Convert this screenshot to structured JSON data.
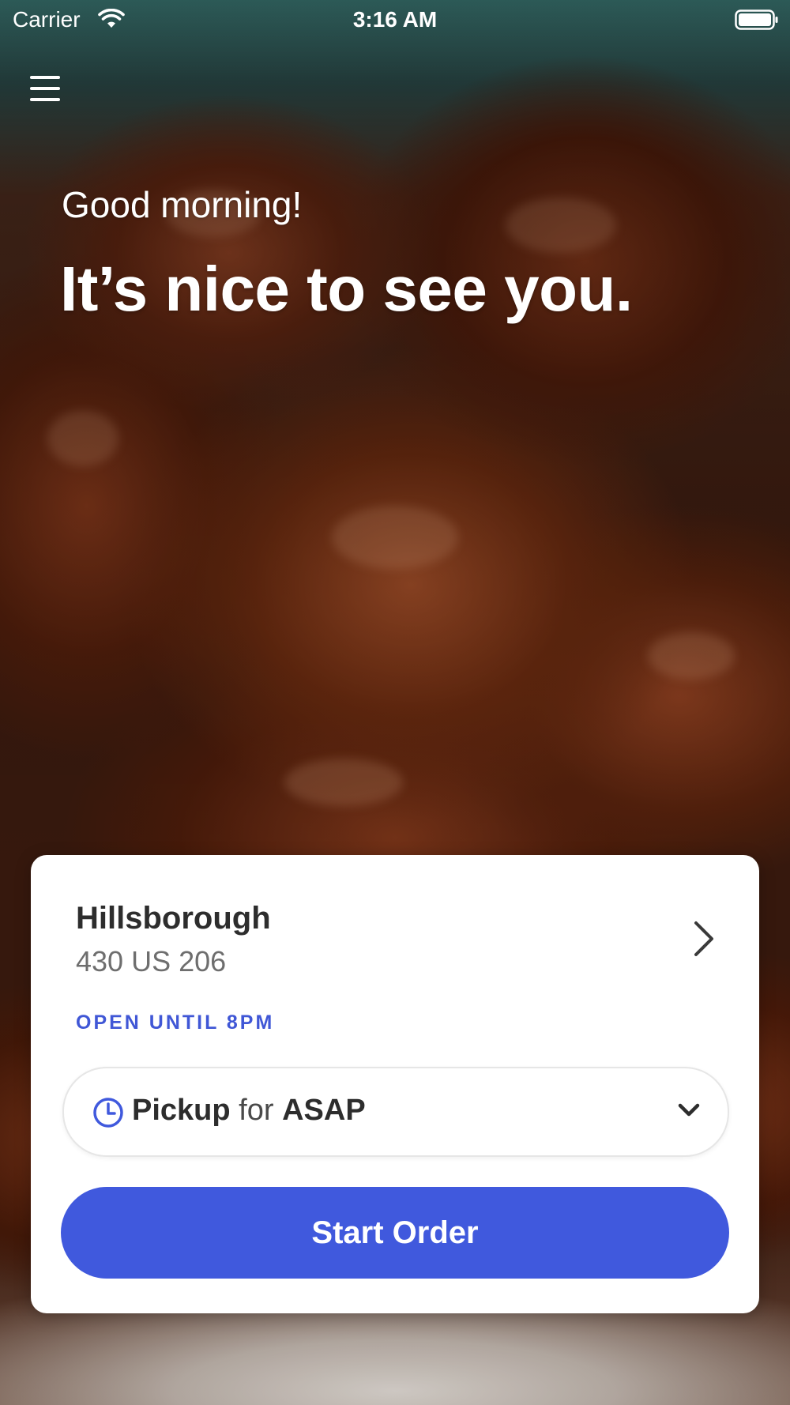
{
  "status_bar": {
    "carrier": "Carrier",
    "time": "3:16 AM"
  },
  "hero": {
    "greeting": "Good morning!",
    "headline": "It’s nice to see you."
  },
  "location": {
    "name": "Hillsborough",
    "address": "430 US 206",
    "hours": "OPEN UNTIL 8PM"
  },
  "order_mode": {
    "mode": "Pickup",
    "connector": "for",
    "time": "ASAP"
  },
  "actions": {
    "start_order_label": "Start Order"
  },
  "icons": {
    "menu": "hamburger-menu-icon",
    "location_link": "chevron-right-icon",
    "time": "clock-icon",
    "dropdown": "chevron-down-icon",
    "wifi": "wifi-icon",
    "battery": "battery-icon"
  },
  "colors": {
    "accent": "#4059DD",
    "hours_text": "#4057D6",
    "card_background": "#FFFFFF",
    "primary_text": "#2D2D2D",
    "secondary_text": "#6E6E6E"
  }
}
